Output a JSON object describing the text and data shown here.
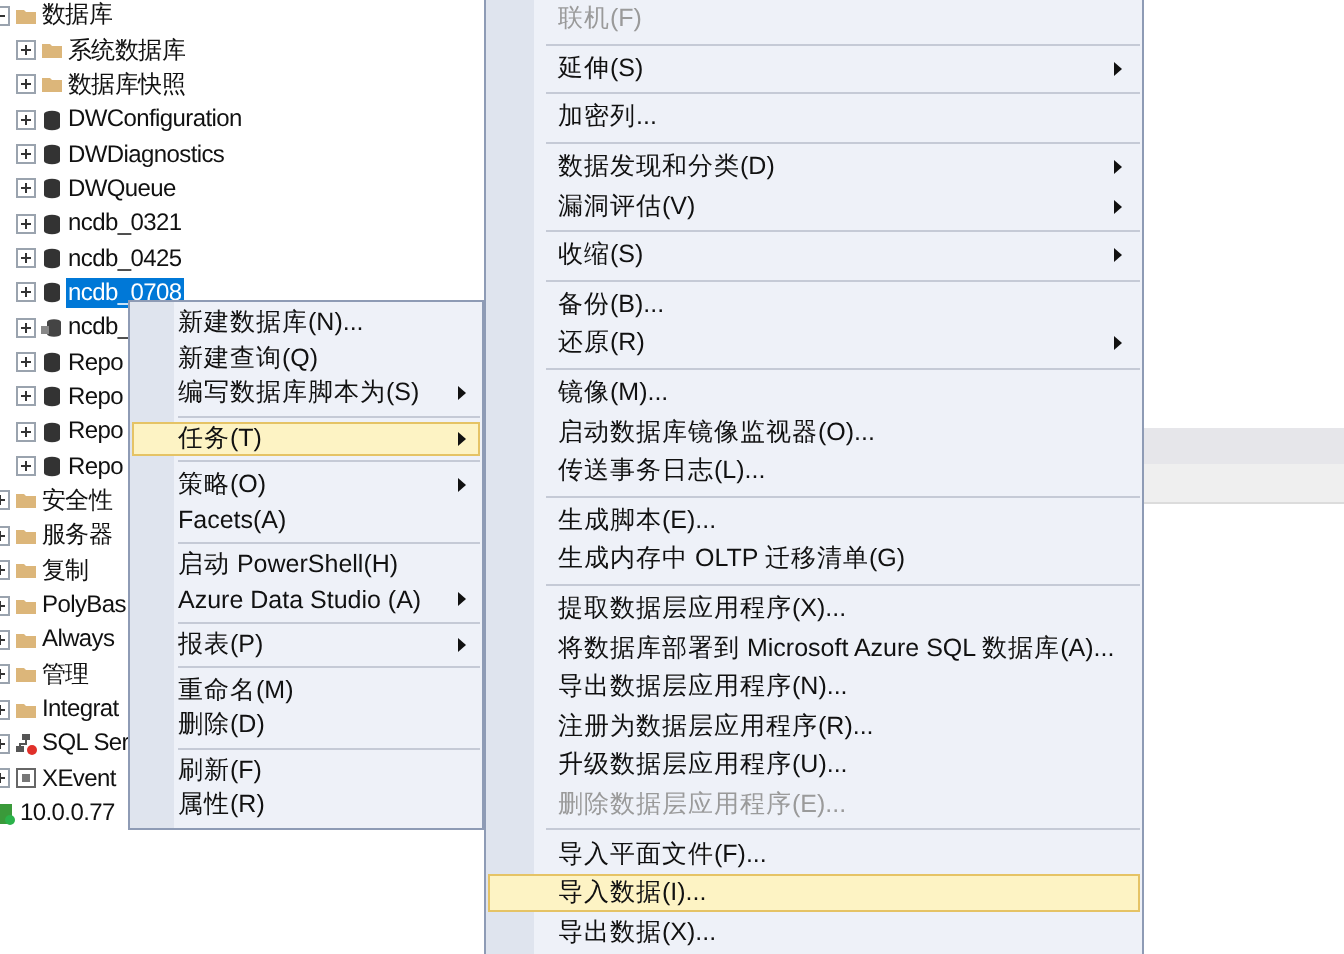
{
  "tree": {
    "items": [
      {
        "label": "数据库",
        "kind": "folder",
        "expanded": true,
        "selected": false,
        "children": [
          {
            "label": "系统数据库",
            "kind": "folder",
            "expanded": false,
            "selected": false
          },
          {
            "label": "数据库快照",
            "kind": "folder",
            "expanded": false,
            "selected": false
          },
          {
            "label": "DWConfiguration",
            "kind": "database",
            "expanded": false,
            "selected": false
          },
          {
            "label": "DWDiagnostics",
            "kind": "database",
            "expanded": false,
            "selected": false
          },
          {
            "label": "DWQueue",
            "kind": "database",
            "expanded": false,
            "selected": false
          },
          {
            "label": "ncdb_0321",
            "kind": "database",
            "expanded": false,
            "selected": false
          },
          {
            "label": "ncdb_0425",
            "kind": "database",
            "expanded": false,
            "selected": false
          },
          {
            "label": "ncdb_0708",
            "kind": "database",
            "expanded": false,
            "selected": true
          },
          {
            "label": "ncdb_",
            "kind": "database_linked",
            "expanded": false,
            "selected": false
          },
          {
            "label": "Repo",
            "kind": "database",
            "expanded": false,
            "selected": false
          },
          {
            "label": "Repo",
            "kind": "database",
            "expanded": false,
            "selected": false
          },
          {
            "label": "Repo",
            "kind": "database",
            "expanded": false,
            "selected": false
          },
          {
            "label": "Repo",
            "kind": "database",
            "expanded": false,
            "selected": false
          }
        ]
      },
      {
        "label": "安全性",
        "kind": "folder",
        "expanded": false,
        "selected": false
      },
      {
        "label": "服务器",
        "kind": "folder",
        "expanded": false,
        "selected": false
      },
      {
        "label": "复制",
        "kind": "folder",
        "expanded": false,
        "selected": false
      },
      {
        "label": "PolyBas",
        "kind": "folder",
        "expanded": false,
        "selected": false
      },
      {
        "label": "Always",
        "kind": "folder",
        "expanded": false,
        "selected": false
      },
      {
        "label": "管理",
        "kind": "folder",
        "expanded": false,
        "selected": false
      },
      {
        "label": "Integrat",
        "kind": "folder",
        "expanded": false,
        "selected": false
      },
      {
        "label": "SQL Ser",
        "kind": "agent",
        "expanded": false,
        "selected": false
      },
      {
        "label": "XEvent",
        "kind": "xevent",
        "expanded": false,
        "selected": false
      }
    ],
    "server": {
      "label": "10.0.0.77",
      "kind": "server"
    }
  },
  "context_menu": {
    "items": [
      {
        "kind": "item",
        "label": "新建数据库(N)...",
        "submenu": false,
        "selected": false
      },
      {
        "kind": "item",
        "label": "新建查询(Q)",
        "submenu": false,
        "selected": false
      },
      {
        "kind": "item",
        "label": "编写数据库脚本为(S)",
        "submenu": true,
        "selected": false
      },
      {
        "kind": "separator"
      },
      {
        "kind": "item",
        "label": "任务(T)",
        "submenu": true,
        "selected": true
      },
      {
        "kind": "separator"
      },
      {
        "kind": "item",
        "label": "策略(O)",
        "submenu": true,
        "selected": false
      },
      {
        "kind": "item",
        "label": "Facets(A)",
        "submenu": false,
        "selected": false
      },
      {
        "kind": "separator"
      },
      {
        "kind": "item",
        "label": "启动 PowerShell(H)",
        "submenu": false,
        "selected": false
      },
      {
        "kind": "item",
        "label": "Azure Data Studio (A)",
        "submenu": true,
        "selected": false
      },
      {
        "kind": "separator"
      },
      {
        "kind": "item",
        "label": "报表(P)",
        "submenu": true,
        "selected": false
      },
      {
        "kind": "separator"
      },
      {
        "kind": "item",
        "label": "重命名(M)",
        "submenu": false,
        "selected": false
      },
      {
        "kind": "item",
        "label": "删除(D)",
        "submenu": false,
        "selected": false
      },
      {
        "kind": "separator"
      },
      {
        "kind": "item",
        "label": "刷新(F)",
        "submenu": false,
        "selected": false
      },
      {
        "kind": "item",
        "label": "属性(R)",
        "submenu": false,
        "selected": false
      }
    ]
  },
  "tasks_submenu": {
    "items": [
      {
        "kind": "item",
        "label": "联机(F)",
        "submenu": false,
        "selected": false,
        "disabled": true
      },
      {
        "kind": "separator"
      },
      {
        "kind": "item",
        "label": "延伸(S)",
        "submenu": true,
        "selected": false,
        "disabled": false
      },
      {
        "kind": "separator"
      },
      {
        "kind": "item",
        "label": "加密列...",
        "submenu": false,
        "selected": false,
        "disabled": false
      },
      {
        "kind": "separator"
      },
      {
        "kind": "item",
        "label": "数据发现和分类(D)",
        "submenu": true,
        "selected": false,
        "disabled": false
      },
      {
        "kind": "item",
        "label": "漏洞评估(V)",
        "submenu": true,
        "selected": false,
        "disabled": false
      },
      {
        "kind": "separator"
      },
      {
        "kind": "item",
        "label": "收缩(S)",
        "submenu": true,
        "selected": false,
        "disabled": false
      },
      {
        "kind": "separator"
      },
      {
        "kind": "item",
        "label": "备份(B)...",
        "submenu": false,
        "selected": false,
        "disabled": false
      },
      {
        "kind": "item",
        "label": "还原(R)",
        "submenu": true,
        "selected": false,
        "disabled": false
      },
      {
        "kind": "separator"
      },
      {
        "kind": "item",
        "label": "镜像(M)...",
        "submenu": false,
        "selected": false,
        "disabled": false
      },
      {
        "kind": "item",
        "label": "启动数据库镜像监视器(O)...",
        "submenu": false,
        "selected": false,
        "disabled": false
      },
      {
        "kind": "item",
        "label": "传送事务日志(L)...",
        "submenu": false,
        "selected": false,
        "disabled": false
      },
      {
        "kind": "separator"
      },
      {
        "kind": "item",
        "label": "生成脚本(E)...",
        "submenu": false,
        "selected": false,
        "disabled": false
      },
      {
        "kind": "item",
        "label": "生成内存中 OLTP 迁移清单(G)",
        "submenu": false,
        "selected": false,
        "disabled": false
      },
      {
        "kind": "separator"
      },
      {
        "kind": "item",
        "label": "提取数据层应用程序(X)...",
        "submenu": false,
        "selected": false,
        "disabled": false
      },
      {
        "kind": "item",
        "label": "将数据库部署到 Microsoft Azure SQL 数据库(A)...",
        "submenu": false,
        "selected": false,
        "disabled": false
      },
      {
        "kind": "item",
        "label": "导出数据层应用程序(N)...",
        "submenu": false,
        "selected": false,
        "disabled": false
      },
      {
        "kind": "item",
        "label": "注册为数据层应用程序(R)...",
        "submenu": false,
        "selected": false,
        "disabled": false
      },
      {
        "kind": "item",
        "label": "升级数据层应用程序(U)...",
        "submenu": false,
        "selected": false,
        "disabled": false
      },
      {
        "kind": "item",
        "label": "删除数据层应用程序(E)...",
        "submenu": false,
        "selected": false,
        "disabled": true
      },
      {
        "kind": "separator"
      },
      {
        "kind": "item",
        "label": "导入平面文件(F)...",
        "submenu": false,
        "selected": false,
        "disabled": false
      },
      {
        "kind": "item",
        "label": "导入数据(I)...",
        "submenu": false,
        "selected": true,
        "disabled": false
      },
      {
        "kind": "item",
        "label": "导出数据(X)...",
        "submenu": false,
        "selected": false,
        "disabled": false
      }
    ]
  }
}
